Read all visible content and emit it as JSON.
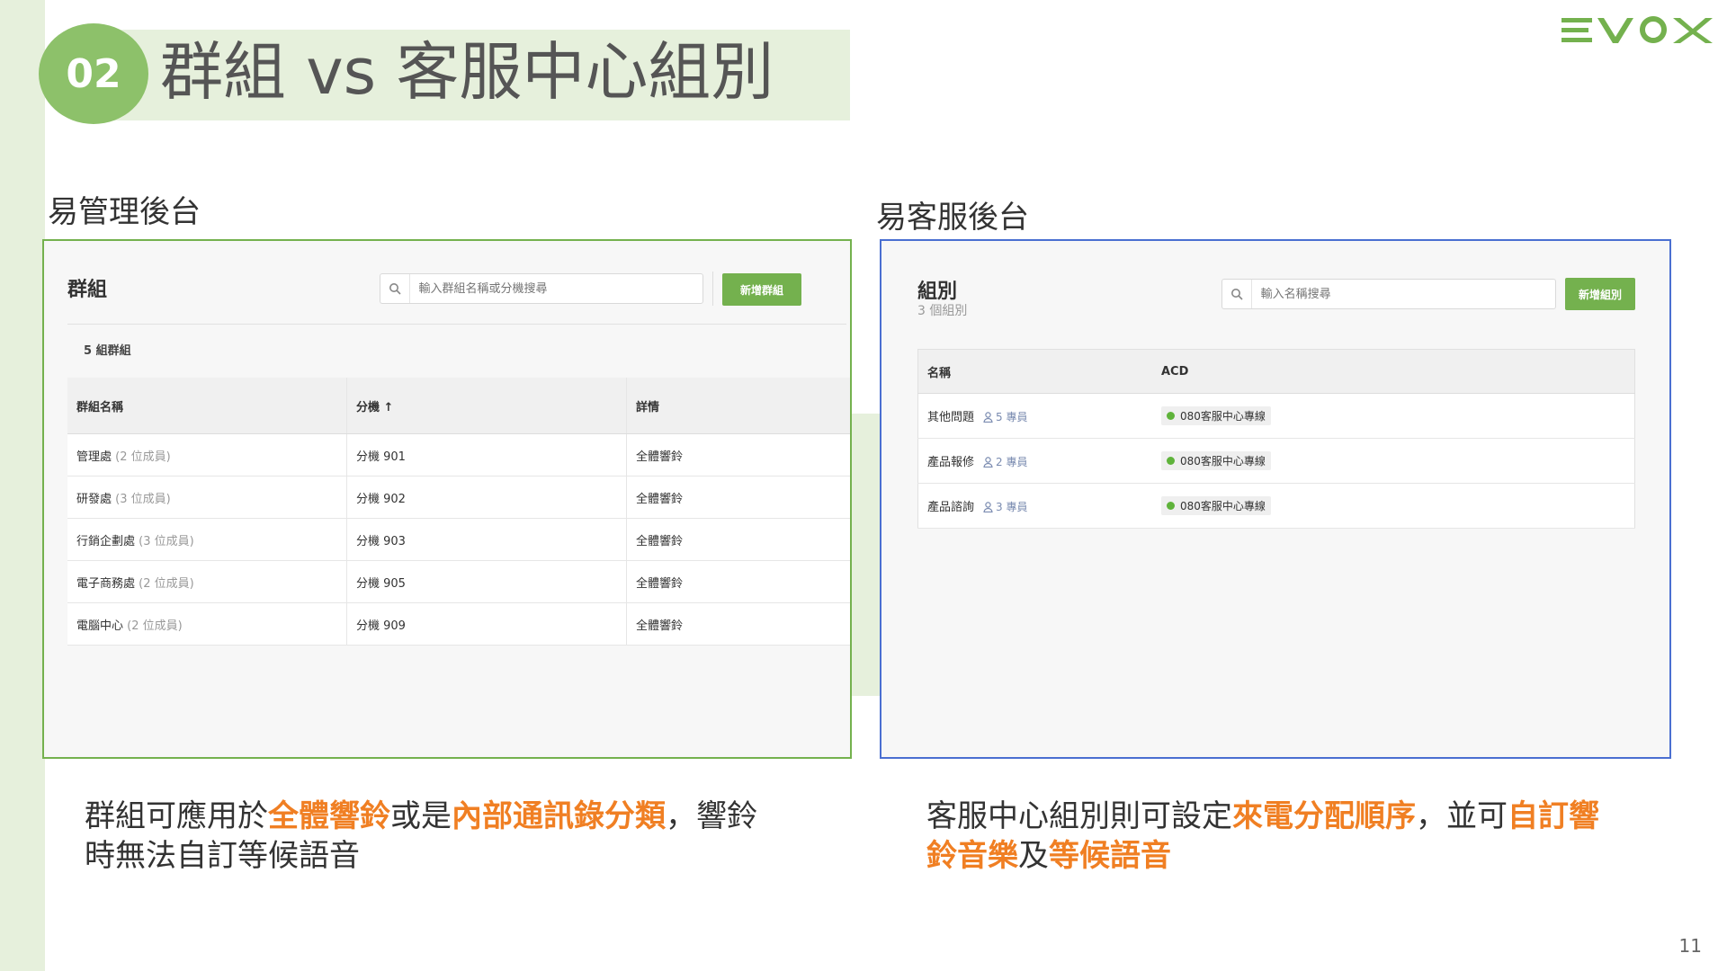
{
  "slide": {
    "badge": "02",
    "title": "群組 vs 客服中心組別",
    "logo": "EVOX",
    "page_number": "11",
    "colors": {
      "accent_green": "#74b14e",
      "light_green": "#e6f0dc",
      "blue_frame": "#4a6fd1",
      "highlight_orange": "#f07f23"
    }
  },
  "left": {
    "label": "易管理後台",
    "panel": {
      "title": "群組",
      "search_placeholder": "輸入群組名稱或分機搜尋",
      "add_button": "新增群組",
      "count_text": "5 組群組",
      "columns": [
        "群組名稱",
        "分機 ↑",
        "詳情"
      ],
      "rows": [
        {
          "name": "管理處",
          "members": "(2 位成員)",
          "ext": "分機 901",
          "detail": "全體響鈴"
        },
        {
          "name": "研發處",
          "members": "(3 位成員)",
          "ext": "分機 902",
          "detail": "全體響鈴"
        },
        {
          "name": "行銷企劃處",
          "members": "(3 位成員)",
          "ext": "分機 903",
          "detail": "全體響鈴"
        },
        {
          "name": "電子商務處",
          "members": "(2 位成員)",
          "ext": "分機 905",
          "detail": "全體響鈴"
        },
        {
          "name": "電腦中心",
          "members": "(2 位成員)",
          "ext": "分機 909",
          "detail": "全體響鈴"
        }
      ]
    },
    "caption": {
      "p1": "群組可應用於",
      "h1": "全體響鈴",
      "p2": "或是",
      "h2": "內部通訊錄分類",
      "p3": "，響鈴時無法自訂等候語音"
    }
  },
  "right": {
    "label": "易客服後台",
    "panel": {
      "title": "組別",
      "subtitle": "3 個組別",
      "search_placeholder": "輸入名稱搜尋",
      "add_button": "新增組別",
      "columns": [
        "名稱",
        "ACD"
      ],
      "rows": [
        {
          "name": "其他問題",
          "agents": "5 專員",
          "acd": "080客服中心專線"
        },
        {
          "name": "產品報修",
          "agents": "2 專員",
          "acd": "080客服中心專線"
        },
        {
          "name": "產品諮詢",
          "agents": "3 專員",
          "acd": "080客服中心專線"
        }
      ]
    },
    "caption": {
      "p1": "客服中心組別則可設定",
      "h1": "來電分配順序",
      "p2": "，並可",
      "h2": "自訂響鈴音樂",
      "p3": "及",
      "h3": "等候語音"
    }
  }
}
